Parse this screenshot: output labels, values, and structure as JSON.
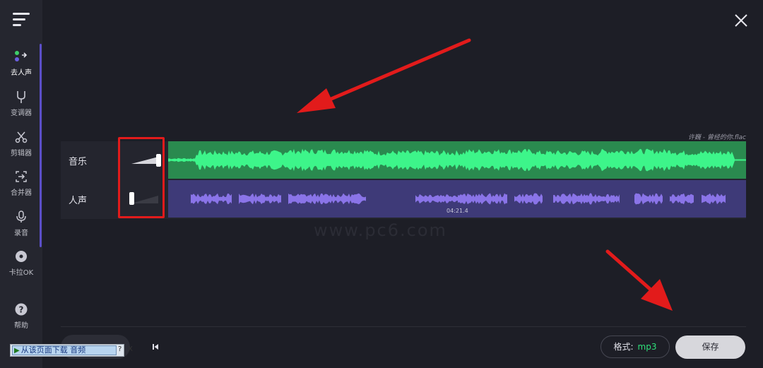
{
  "sidebar": {
    "items": [
      {
        "label": "去人声",
        "icon": "vocal-remover-icon",
        "active": true
      },
      {
        "label": "变调器",
        "icon": "tuning-fork-icon"
      },
      {
        "label": "剪辑器",
        "icon": "scissors-icon"
      },
      {
        "label": "合并器",
        "icon": "merge-icon"
      },
      {
        "label": "录音",
        "icon": "microphone-icon"
      },
      {
        "label": "卡拉OK",
        "icon": "karaoke-disc-icon"
      },
      {
        "label": "帮助",
        "icon": "help-icon"
      }
    ]
  },
  "file": {
    "name": "许巍 - 曾经的你.flac"
  },
  "tracks": {
    "music": {
      "label": "音乐",
      "volume": 1.0,
      "color": "#2a8a4f",
      "wave_color": "#3df58a"
    },
    "voice": {
      "label": "人声",
      "volume": 0.0,
      "color": "#3e3a78",
      "wave_color": "#8a74e8"
    }
  },
  "playhead": {
    "time": "04:21.4"
  },
  "watermark": "www.pc6.com",
  "footer": {
    "format_label": "格式:",
    "format_value": "mp3",
    "save_label": "保存"
  },
  "download_bar": {
    "label": "从该页面下载 音频",
    "help": "?",
    "close": "X"
  },
  "colors": {
    "accent": "#5b4fc9",
    "annotation_red": "#e21b1b"
  }
}
